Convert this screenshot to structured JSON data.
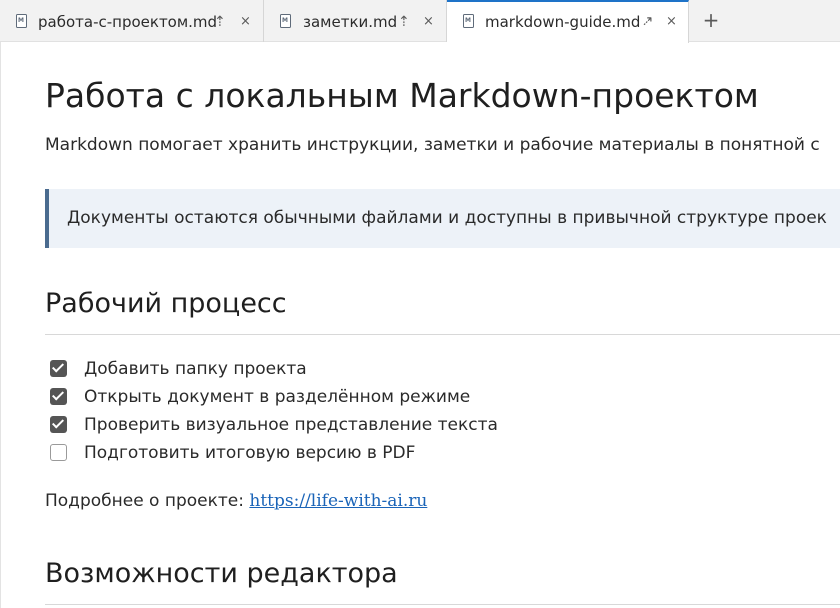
{
  "tabs": [
    {
      "label": "работа-с-проектом.md",
      "pin": "⇡",
      "close": "×",
      "active": false
    },
    {
      "label": "заметки.md",
      "pin": "⇡",
      "close": "×",
      "active": false
    },
    {
      "label": "markdown-guide.md",
      "pin": "⇡",
      "close": "×",
      "active": true
    }
  ],
  "new_tab_label": "+",
  "document": {
    "title": "Работа с локальным Markdown-проектом",
    "intro": "Markdown помогает хранить инструкции, заметки и рабочие материалы в понятной с",
    "callout": "Документы остаются обычными файлами и доступны в привычной структуре проек",
    "section1": {
      "heading": "Рабочий процесс",
      "tasks": [
        {
          "label": "Добавить папку проекта",
          "checked": true
        },
        {
          "label": "Открыть документ в разделённом режиме",
          "checked": true
        },
        {
          "label": "Проверить визуальное представление текста",
          "checked": true
        },
        {
          "label": "Подготовить итоговую версию в PDF",
          "checked": false
        }
      ]
    },
    "more_label": "Подробнее о проекте: ",
    "more_link": "https://life-with-ai.ru",
    "section2": {
      "heading": "Возможности редактора"
    }
  },
  "colors": {
    "accent": "#1e73c8",
    "link": "#1a64b8",
    "callout_bg": "#edf2f8",
    "callout_border": "#4a6b8f"
  }
}
